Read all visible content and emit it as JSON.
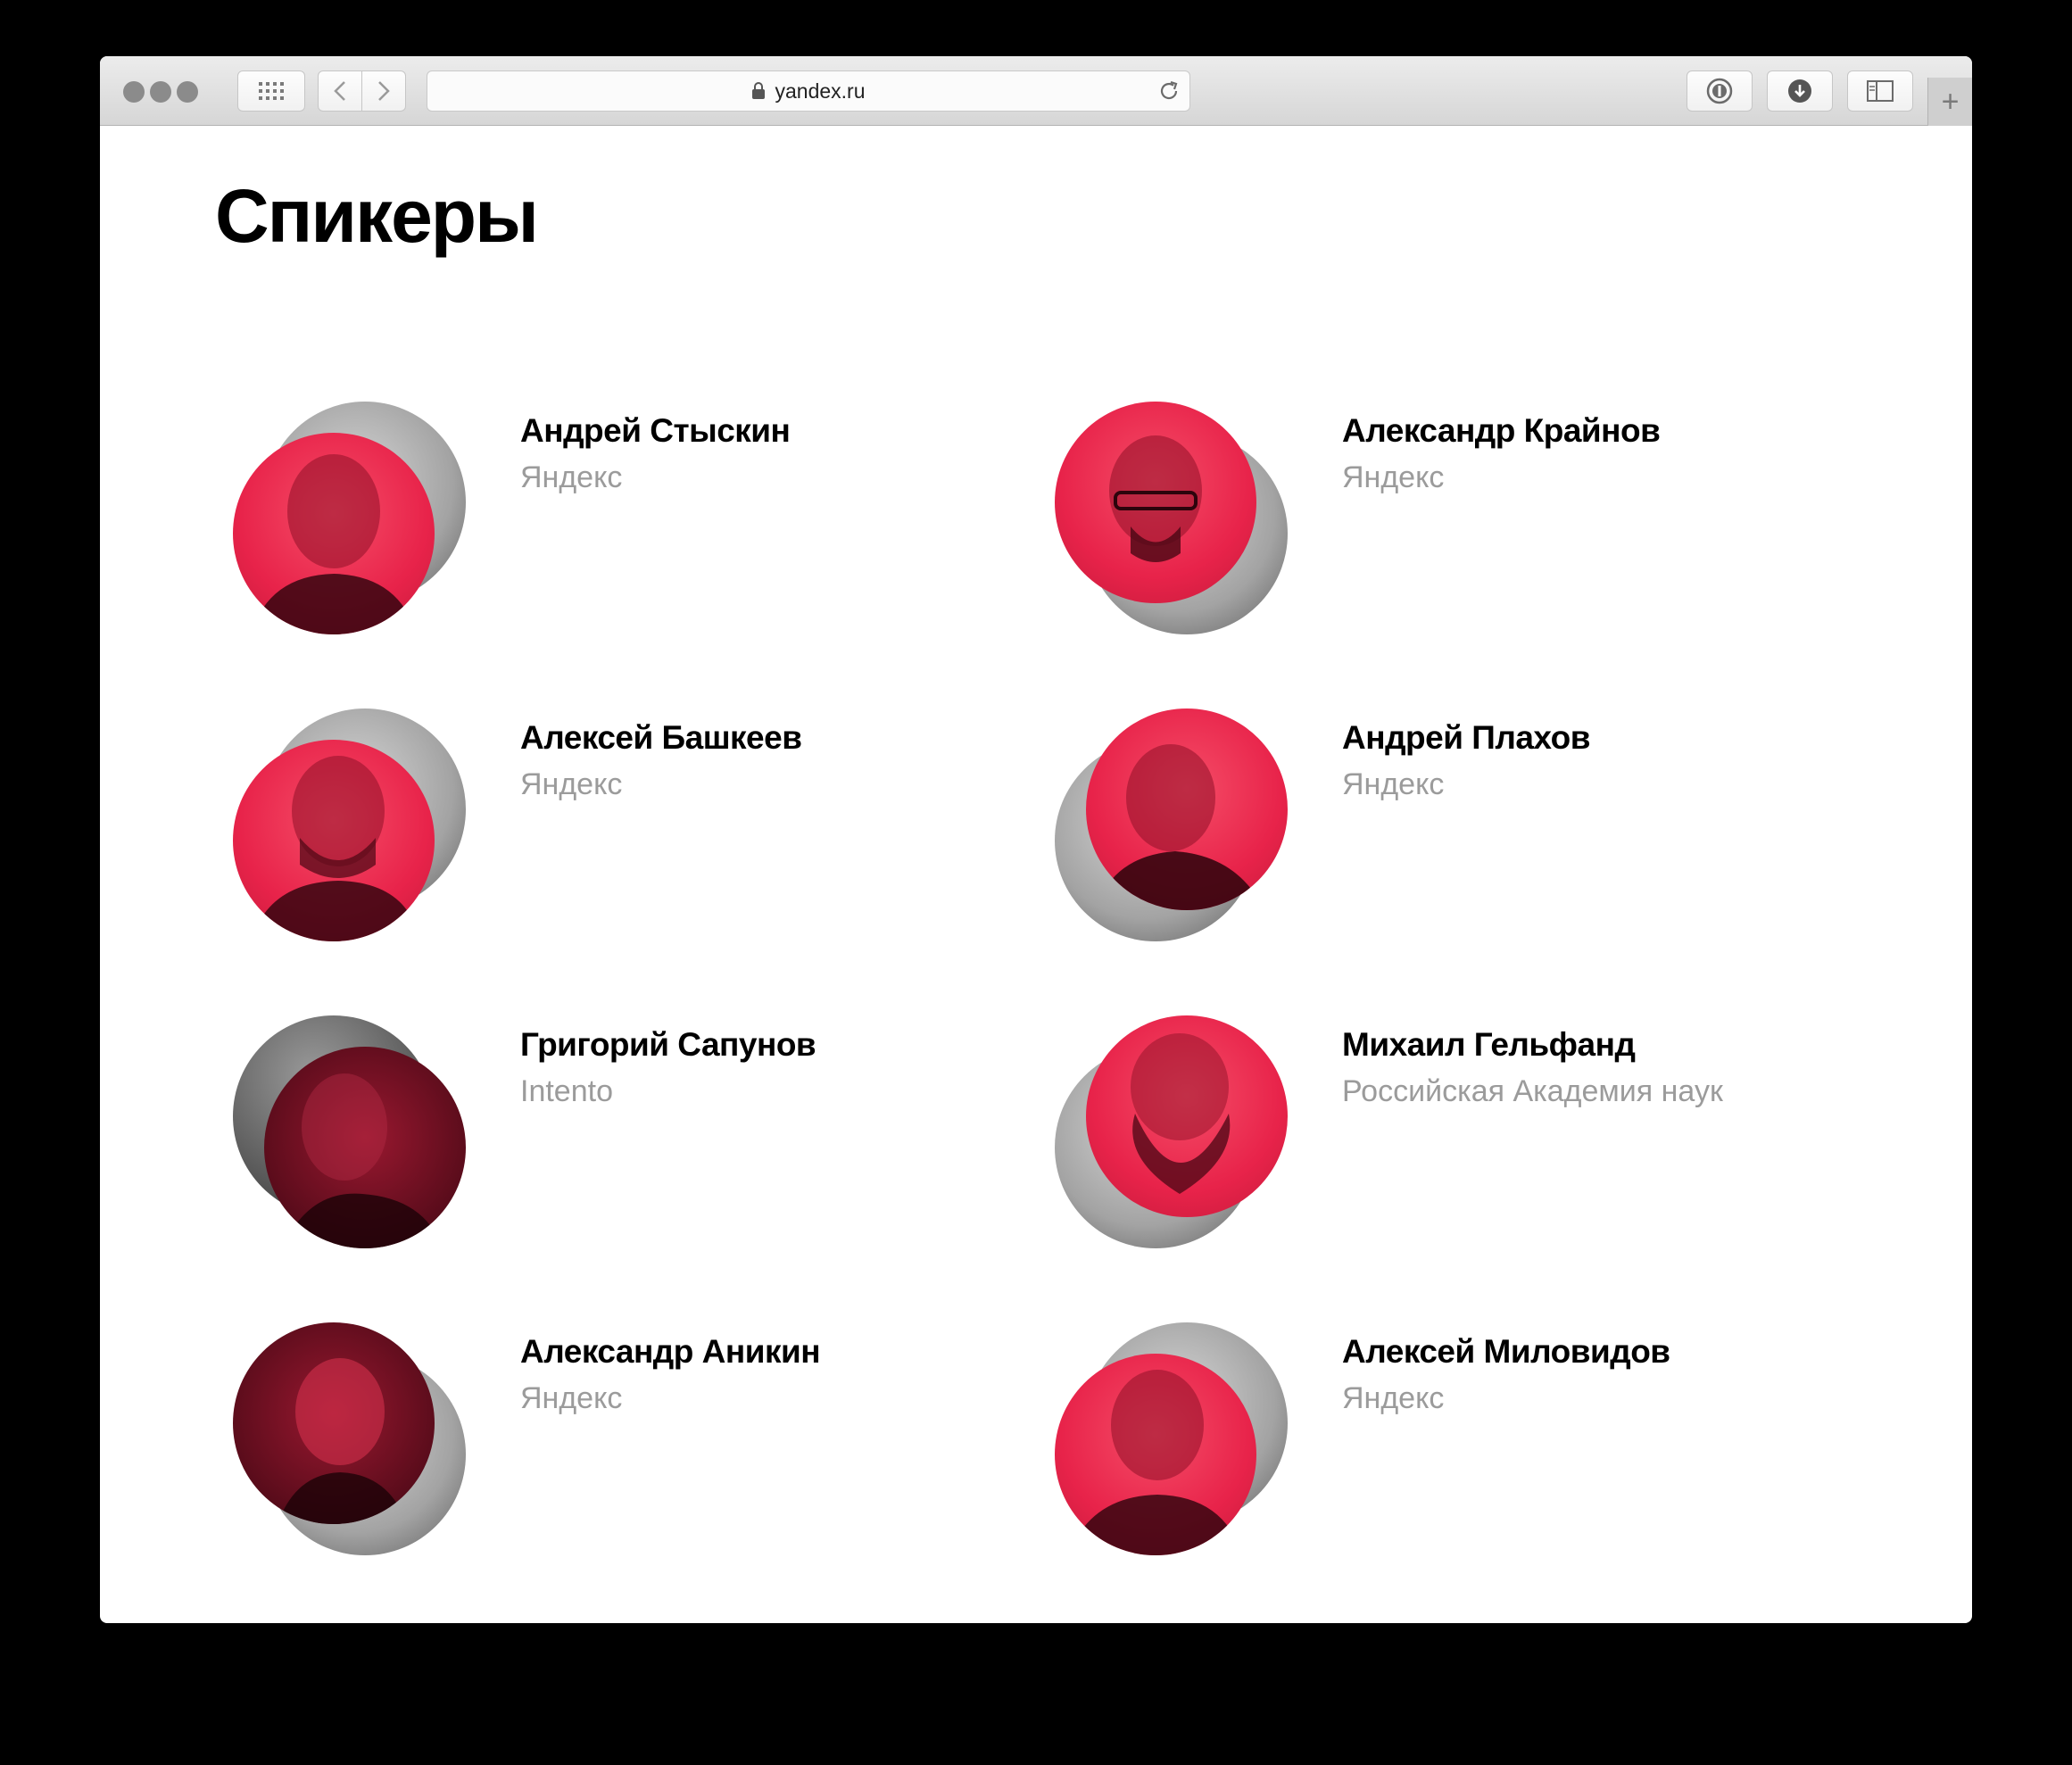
{
  "browser": {
    "url": "yandex.ru",
    "icons": [
      "grid-icon",
      "back-icon",
      "forward-icon",
      "lock-icon",
      "reload-icon",
      "password-icon",
      "download-icon",
      "sidebar-icon",
      "new-tab-icon"
    ]
  },
  "page": {
    "title": "Спикеры"
  },
  "colors": {
    "accent": "#e8234a",
    "muted_text": "#9b9b9b"
  },
  "speakers": [
    {
      "name": "Андрей Стыскин",
      "company": "Яндекс"
    },
    {
      "name": "Александр Крайнов",
      "company": "Яндекс"
    },
    {
      "name": "Алексей Башкеев",
      "company": "Яндекс"
    },
    {
      "name": "Андрей Плахов",
      "company": "Яндекс"
    },
    {
      "name": "Григорий Сапунов",
      "company": "Intento"
    },
    {
      "name": "Михаил Гельфанд",
      "company": "Российская Академия наук"
    },
    {
      "name": "Александр Аникин",
      "company": "Яндекс"
    },
    {
      "name": "Алексей Миловидов",
      "company": "Яндекс"
    }
  ]
}
